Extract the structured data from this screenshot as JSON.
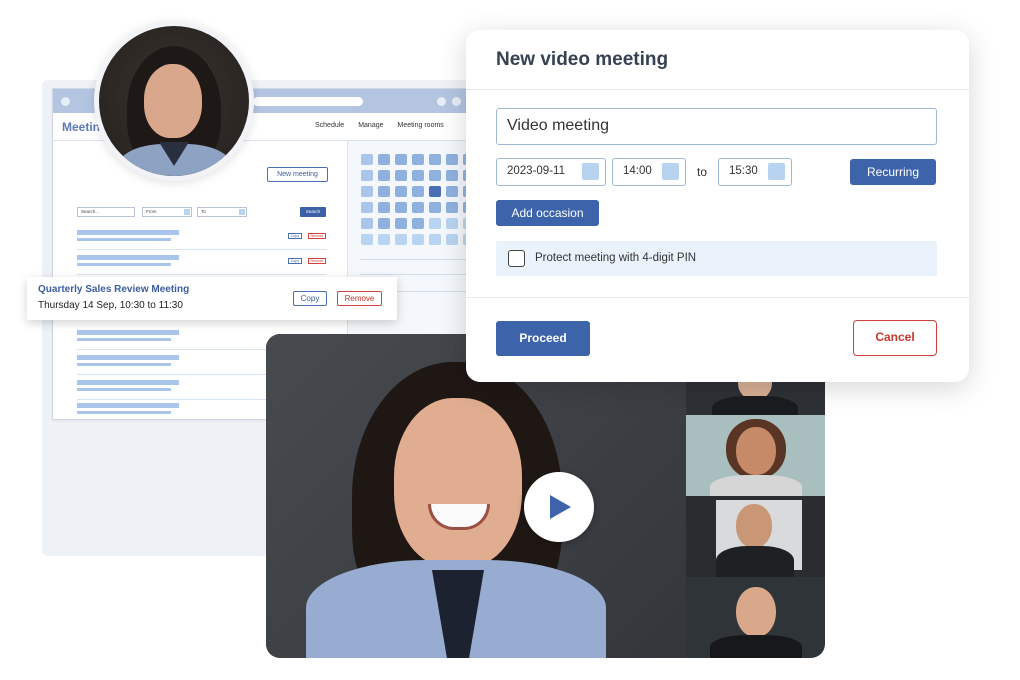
{
  "app": {
    "brand": "Meetin",
    "nav": [
      "Schedule",
      "Manage",
      "Meeting rooms"
    ],
    "new_meeting_label": "New meeting",
    "filters": {
      "search": "Search...",
      "from": "From",
      "to": "To",
      "search_button": "Search"
    },
    "row_actions": {
      "copy": "Copy",
      "remove": "Remove"
    }
  },
  "meeting_card": {
    "title": "Quarterly Sales Review Meeting",
    "time": "Thursday 14 Sep, 10:30 to 11:30",
    "copy_label": "Copy",
    "remove_label": "Remove"
  },
  "dialog": {
    "title": "New video meeting",
    "meeting_name": "Video meeting",
    "date": "2023-09-11",
    "start_time": "14:00",
    "to_label": "to",
    "end_time": "15:30",
    "recurring_label": "Recurring",
    "add_occasion_label": "Add occasion",
    "pin_label": "Protect meeting with 4-digit PIN",
    "pin_checked": false,
    "proceed_label": "Proceed",
    "cancel_label": "Cancel"
  },
  "colors": {
    "primary": "#3d64ab",
    "danger": "#d2423d",
    "field_border": "#9fb8d6",
    "pin_background": "#eaf2fb"
  },
  "icons": {
    "play": "play-icon",
    "checkbox": "checkbox-icon"
  }
}
